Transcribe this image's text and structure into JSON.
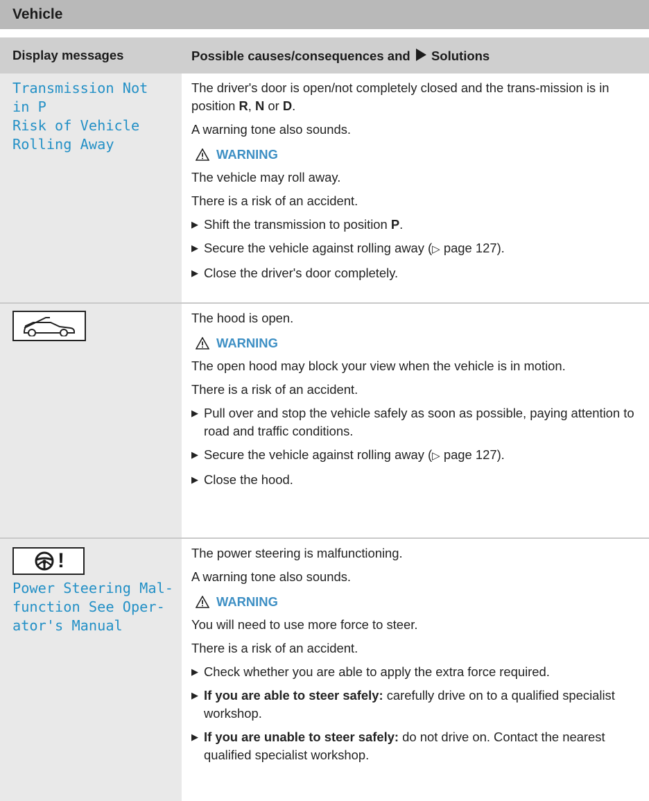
{
  "section": {
    "title": "Vehicle"
  },
  "table": {
    "col_messages": "Display messages",
    "col_causes_pre": "Possible causes/consequences and",
    "col_causes_post": "Solutions"
  },
  "rows": [
    {
      "message_lines": "Transmission Not\nin P\nRisk of Vehicle\nRolling Away",
      "intro_1_pre": "The driver's door is open/not completely closed and the trans-mission is in position ",
      "gear_r": "R",
      "sep_1": ", ",
      "gear_n": "N",
      "sep_2": " or ",
      "gear_d": "D",
      "sep_3": ".",
      "intro_2": "A warning tone also sounds.",
      "warning_label": "WARNING",
      "warning_text_1": "The vehicle may roll away.",
      "warning_text_2": "There is a risk of an accident.",
      "step_1_pre": "Shift the transmission to position ",
      "step_1_bold": "P",
      "step_1_post": ".",
      "step_2_pre": "Secure the vehicle against rolling away (",
      "step_2_ref": "page 127",
      "step_2_post": ").",
      "step_3": "Close the driver's door completely."
    },
    {
      "icon": "hood-open-icon",
      "intro_1": "The hood is open.",
      "warning_label": "WARNING",
      "warning_text_1": "The open hood may block your view when the vehicle is in motion.",
      "warning_text_2": "There is a risk of an accident.",
      "step_1": "Pull over and stop the vehicle safely as soon as possible, paying attention to road and traffic conditions.",
      "step_2_pre": "Secure the vehicle against rolling away (",
      "step_2_ref": "page 127",
      "step_2_post": ").",
      "step_3": "Close the hood."
    },
    {
      "icon": "steering-wheel-warning-icon",
      "icon_symbol": "!",
      "message_lines": "Power Steering Mal-\nfunction See Oper-\nator's Manual",
      "intro_1": "The power steering is malfunctioning.",
      "intro_2": "A warning tone also sounds.",
      "warning_label": "WARNING",
      "warning_text_1": "You will need to use more force to steer.",
      "warning_text_2": "There is a risk of an accident.",
      "step_1": "Check whether you are able to apply the extra force required.",
      "step_2_bold": "If you are able to steer safely:",
      "step_2_post": " carefully drive on to a qualified specialist workshop.",
      "step_3_bold": "If you are unable to steer safely:",
      "step_3_post": " do not drive on. Contact the nearest qualified specialist workshop."
    }
  ],
  "colors": {
    "message_blue": "#2390c6",
    "warning_blue": "#3d8fc4",
    "header_gray": "#b9b9b9",
    "column_header_gray": "#cfcfcf",
    "left_column_gray": "#e9e9e9"
  }
}
